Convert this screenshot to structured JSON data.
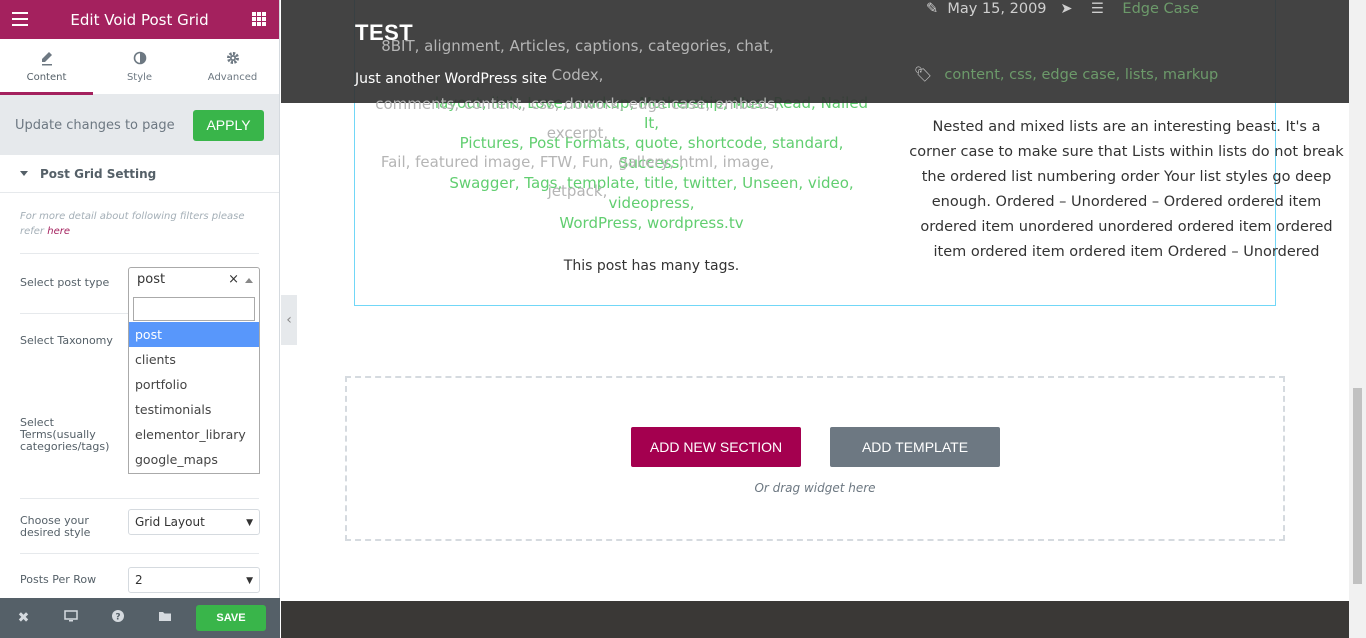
{
  "panel": {
    "title": "Edit Void Post Grid",
    "tabs": [
      {
        "label": "Content",
        "icon": "pencil-icon"
      },
      {
        "label": "Style",
        "icon": "contrast-icon"
      },
      {
        "label": "Advanced",
        "icon": "gear-icon"
      }
    ],
    "update_text": "Update changes to page",
    "apply_label": "APPLY",
    "section_title": "Post Grid Setting",
    "note_text": "For more detail about following filters please refer ",
    "note_link": "here",
    "post_type_label": "Select post type",
    "post_type_value": "post",
    "post_type_options": [
      "post",
      "clients",
      "portfolio",
      "testimonials",
      "elementor_library",
      "google_maps"
    ],
    "taxonomy_label": "Select Taxonomy",
    "terms_label": "Select Terms(usually categories/tags)",
    "style_label": "Choose your desired style",
    "style_value": "Grid Layout",
    "per_row_label": "Posts Per Row",
    "per_row_value": "2",
    "save_label": "SAVE"
  },
  "site": {
    "title": "TEST",
    "tagline": "Just another WordPress site"
  },
  "post_left": {
    "tags_html_order": [
      "8BIT",
      "alignment",
      "Articles",
      "captions",
      "categories",
      "chat",
      "Codex",
      "comments",
      "content",
      "css",
      "dowork",
      "edge case",
      "embeds",
      "excerpt",
      "Fail",
      "featured image",
      "FTW",
      "Fun",
      "gallery",
      "html",
      "image",
      "jetpack",
      "layout",
      "link",
      "Love",
      "markup",
      "Mothership",
      "Must Read",
      "Nailed It",
      "Pictures",
      "Post Formats",
      "quote",
      "shortcode",
      "standard",
      "Success",
      "Swagger",
      "Tags",
      "template",
      "title",
      "twitter",
      "Unseen",
      "video",
      "videopress",
      "WordPress",
      "wordpress.tv"
    ],
    "visible_lines": [
      "layout, link, Love, markup, Mothership, Must Read, Nailed It,",
      "Pictures, Post Formats, quote, shortcode, standard, Success,",
      "Swagger, Tags, template, title, twitter, Unseen, video, videopress,",
      "WordPress, wordpress.tv"
    ],
    "hidden_lines": [
      "8BIT, alignment, Articles, captions, categories, chat, Codex,",
      "comments, content, css, dowork, edge case, embeds, excerpt,",
      "Fail, featured image, FTW, Fun, gallery, html, image, jetpack,"
    ],
    "excerpt": "This post has many tags."
  },
  "post_right": {
    "date": "May 15, 2009",
    "category": "Edge Case",
    "tags": "content, css, edge case, lists, markup",
    "excerpt": "Nested and mixed lists are an interesting beast. It's a corner case to make sure that Lists within lists do not break the ordered list numbering order Your list styles go deep enough. Ordered – Unordered – Ordered ordered item ordered item unordered unordered ordered item ordered item ordered item ordered item Ordered – Unordered"
  },
  "drop_zone": {
    "add_section": "ADD NEW SECTION",
    "add_template": "ADD TEMPLATE",
    "hint": "Or drag widget here"
  },
  "colors": {
    "brand": "#a4215e",
    "apply": "#39b54a",
    "selected_option": "#5897fb"
  }
}
